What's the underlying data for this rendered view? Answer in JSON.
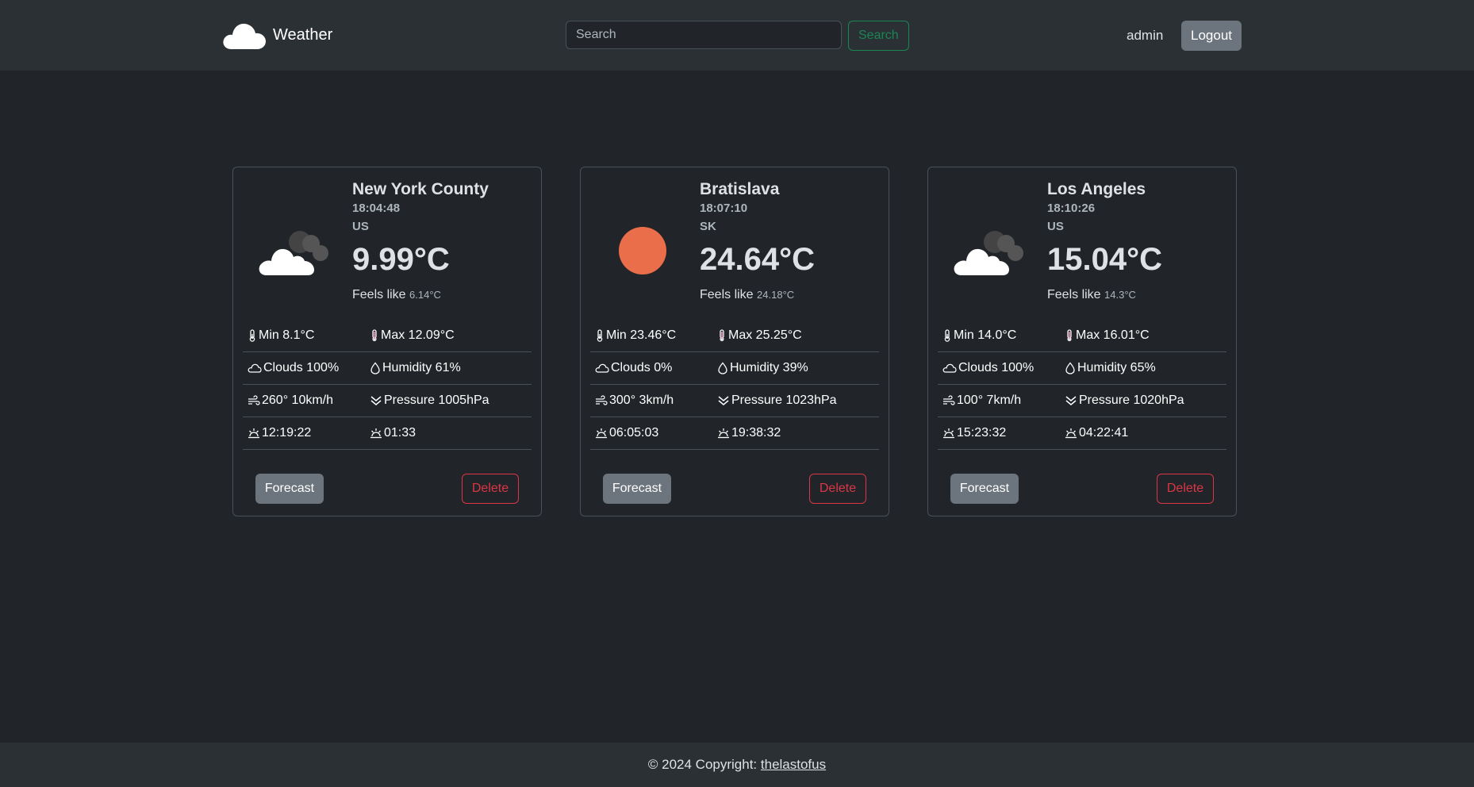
{
  "header": {
    "brand": "Weather",
    "search_placeholder": "Search",
    "search_label": "Search",
    "user": "admin",
    "logout_label": "Logout"
  },
  "cards": [
    {
      "icon": "cloudy-icon",
      "city": "New York County",
      "time": "18:04:48",
      "country": "US",
      "temp": "9.99°C",
      "feels_label": "Feels like",
      "feels_value": "6.14°C",
      "min": "Min 8.1°C",
      "max": "Max 12.09°C",
      "clouds": "Clouds 100%",
      "humidity": "Humidity 61%",
      "wind": "260° 10km/h",
      "pressure": "Pressure 1005hPa",
      "sunrise": "12:19:22",
      "sunset": "01:33",
      "forecast_label": "Forecast",
      "delete_label": "Delete"
    },
    {
      "icon": "sun-icon",
      "city": "Bratislava",
      "time": "18:07:10",
      "country": "SK",
      "temp": "24.64°C",
      "feels_label": "Feels like",
      "feels_value": "24.18°C",
      "min": "Min 23.46°C",
      "max": "Max 25.25°C",
      "clouds": "Clouds 0%",
      "humidity": "Humidity 39%",
      "wind": "300° 3km/h",
      "pressure": "Pressure 1023hPa",
      "sunrise": "06:05:03",
      "sunset": "19:38:32",
      "forecast_label": "Forecast",
      "delete_label": "Delete"
    },
    {
      "icon": "cloudy-icon",
      "city": "Los Angeles",
      "time": "18:10:26",
      "country": "US",
      "temp": "15.04°C",
      "feels_label": "Feels like",
      "feels_value": "14.3°C",
      "min": "Min 14.0°C",
      "max": "Max 16.01°C",
      "clouds": "Clouds 100%",
      "humidity": "Humidity 65%",
      "wind": "100° 7km/h",
      "pressure": "Pressure 1020hPa",
      "sunrise": "15:23:32",
      "sunset": "04:22:41",
      "forecast_label": "Forecast",
      "delete_label": "Delete"
    }
  ],
  "footer": {
    "copyright": "© 2024 Copyright:",
    "link": "thelastofus"
  },
  "colors": {
    "background": "#212529",
    "navbar": "#2b3035",
    "success": "#198754",
    "danger": "#dc3545",
    "secondary": "#6c757d",
    "sun": "#eb6e4b"
  }
}
